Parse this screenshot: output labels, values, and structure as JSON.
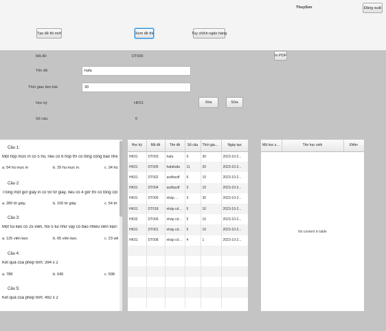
{
  "header": {
    "username": "ThuySon",
    "logout_label": "Đăng xuất",
    "create_label": "Tạo đề thi mới",
    "view_label": "Xem đề thi",
    "bank_label": "Tùy chỉnh ngân hàng"
  },
  "form": {
    "code_label": "Mã đề:",
    "code_value": "DT006",
    "pdf_label": "In PDF",
    "name_label": "Tên đề:",
    "name_value": "hafa",
    "time_label": "Thời gian làm bài:",
    "time_value": "30",
    "semester_label": "Học kỳ",
    "semester_value": "HK01",
    "delete_label": "Xóa",
    "edit_label": "Sửa",
    "count_label": "Số câu:",
    "count_value": "6"
  },
  "questions": [
    {
      "title": "Câu 1:",
      "text": "Một hộp mực in có 5 hủ, nếu có 6 hộp thì có tổng cộng bao nhiêu hủ",
      "a": "a. 54 hủ mực in",
      "b": "b. 29 hủ mực in.",
      "c": "c. 34 hủ"
    },
    {
      "title": "Câu 2:",
      "text": "Trong một giờ giây in có 50 tờ giấy, nếu có 4 giờ thì có tổng cộng bao",
      "a": "a. 280 tờ giấy.",
      "b": "b. 100 tờ giấy.",
      "c": "c. 54 tờ"
    },
    {
      "title": "Câu 3:",
      "text": "Một túi kẹo có 25 viên, hỏi 5 túi như vậy có bao nhiêu viên kẹo?",
      "a": "a. 125 viên kẹo.",
      "b": "b. 65 viên kẹo.",
      "c": "c. 23 viê"
    },
    {
      "title": "Câu 4:",
      "text": "Kết quả của phép tính: 394 x 2",
      "a": "a. 788",
      "b": "b. 645",
      "c": "c. 598"
    },
    {
      "title": "Câu 5:",
      "text": "Kết quả của phép tính: 492 x 2",
      "a": "",
      "b": "",
      "c": ""
    }
  ],
  "exam_table": {
    "headers": [
      "Học kỳ",
      "Mã đề",
      "Tên đề",
      "Số câu",
      "Thời gian ...",
      "Ngày tạo"
    ],
    "rows": [
      [
        "HK01",
        "DT003",
        "hafa",
        "9",
        "30",
        "2023-10-2..."
      ],
      [
        "HK01",
        "DT005",
        "hafahafa",
        "11",
        "20",
        "2023-10-2..."
      ],
      [
        "HK01",
        "DT002",
        "asdfacdf",
        "6",
        "10",
        "2023-10-2..."
      ],
      [
        "HK01",
        "DT004",
        "asdfacdf",
        "3",
        "10",
        "2023-10-2..."
      ],
      [
        "HK01",
        "DT005",
        "nháp ...",
        "3",
        "30",
        "2023-10-2..."
      ],
      [
        "HK01",
        "DT018",
        "nháp cd-đ...",
        "5",
        "10",
        "2023-10-2..."
      ],
      [
        "HK02",
        "DT006",
        "nháp cd-đ...",
        "5",
        "10",
        "2023-10-2..."
      ],
      [
        "HK01",
        "DT001",
        "nháp cd-đ...",
        "5",
        "10",
        "2023-10-2..."
      ],
      [
        "HK01",
        "DT008",
        "nháp cd-đ...",
        "4",
        "1",
        "2023-10-2..."
      ]
    ]
  },
  "score_table": {
    "headers": [
      "Mã học sinh",
      "Tên học sinh",
      "Điểm"
    ],
    "empty_text": "No content in table"
  }
}
